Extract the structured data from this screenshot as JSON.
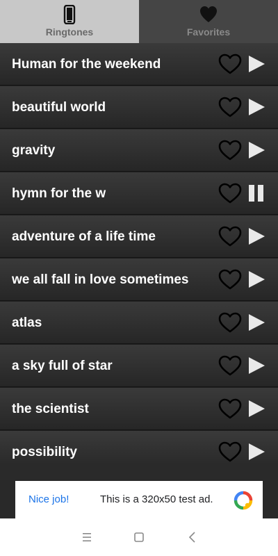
{
  "tabs": [
    {
      "label": "Ringtones",
      "icon": "phone-icon",
      "selected": true
    },
    {
      "label": "Favorites",
      "icon": "heart-icon",
      "selected": false
    }
  ],
  "songs": [
    {
      "title": "Human for the weekend",
      "state": "play"
    },
    {
      "title": "beautiful world",
      "state": "play"
    },
    {
      "title": "gravity",
      "state": "play"
    },
    {
      "title": "hymn for the w",
      "state": "pause"
    },
    {
      "title": "adventure of a life time",
      "state": "play"
    },
    {
      "title": "we all fall in love sometimes",
      "state": "play"
    },
    {
      "title": "atlas",
      "state": "play"
    },
    {
      "title": "a sky full of star",
      "state": "play"
    },
    {
      "title": "the scientist",
      "state": "play"
    },
    {
      "title": "possibility",
      "state": "play"
    }
  ],
  "ad": {
    "cta": "Nice job!",
    "text": "This is a 320x50 test ad."
  },
  "navbar": [
    "menu-icon",
    "home-square-icon",
    "back-chevron-icon"
  ],
  "colors": {
    "tab_selected": "#c8c8c8",
    "tab_unselected": "#454545",
    "row_text": "#ffffff",
    "ad_cta": "#1a73e8"
  }
}
